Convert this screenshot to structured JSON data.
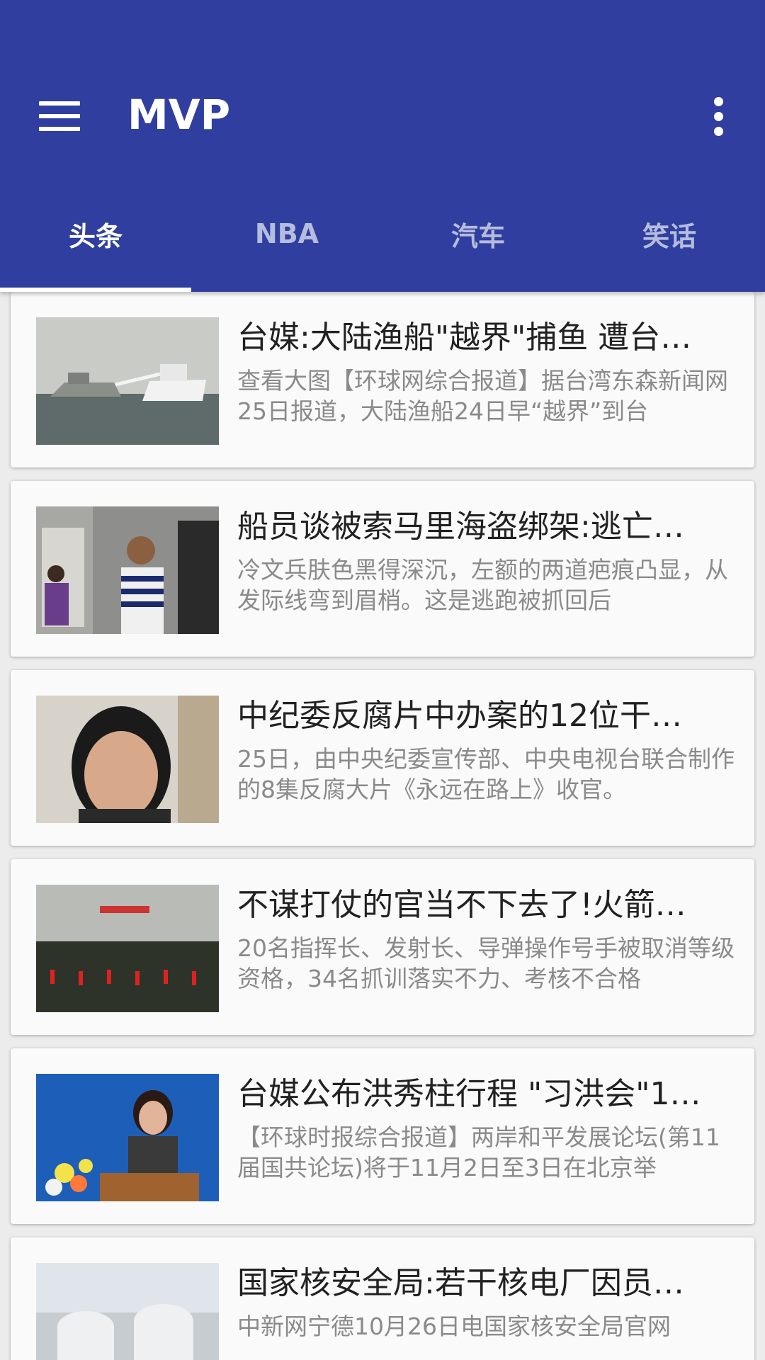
{
  "app": {
    "title": "MVP"
  },
  "toolbar": {
    "menu_icon": "hamburger-menu-icon",
    "overflow_icon": "more-vert-icon"
  },
  "colors": {
    "primary": "#303f9f",
    "card_bg": "#fafafa",
    "title_text": "#212121",
    "desc_text": "#8a8a8a"
  },
  "tabs": [
    {
      "label": "头条",
      "selected": true
    },
    {
      "label": "NBA",
      "selected": false
    },
    {
      "label": "汽车",
      "selected": false
    },
    {
      "label": "笑话",
      "selected": false
    }
  ],
  "news": [
    {
      "title": "台媒:大陆渔船\"越界\"捕鱼 遭台…",
      "desc": "查看大图【环球网综合报道】据台湾东森新闻网25日报道，大陆渔船24日早“越界”到台"
    },
    {
      "title": "船员谈被索马里海盗绑架:逃亡…",
      "desc": "冷文兵肤色黑得深沉，左额的两道疤痕凸显，从发际线弯到眉梢。这是逃跑被抓回后"
    },
    {
      "title": "中纪委反腐片中办案的12位干…",
      "desc": "25日，由中央纪委宣传部、中央电视台联合制作的8集反腐大片《永远在路上》收官。"
    },
    {
      "title": "不谋打仗的官当不下去了!火箭…",
      "desc": "20名指挥长、发射长、导弹操作号手被取消等级资格，34名抓训落实不力、考核不合格"
    },
    {
      "title": "台媒公布洪秀柱行程 \"习洪会\"1…",
      "desc": "【环球时报综合报道】两岸和平发展论坛(第11届国共论坛)将于11月2日至3日在北京举"
    },
    {
      "title": "国家核安全局:若干核电厂因员…",
      "desc": "中新网宁德10月26日电国家核安全局官网"
    }
  ]
}
